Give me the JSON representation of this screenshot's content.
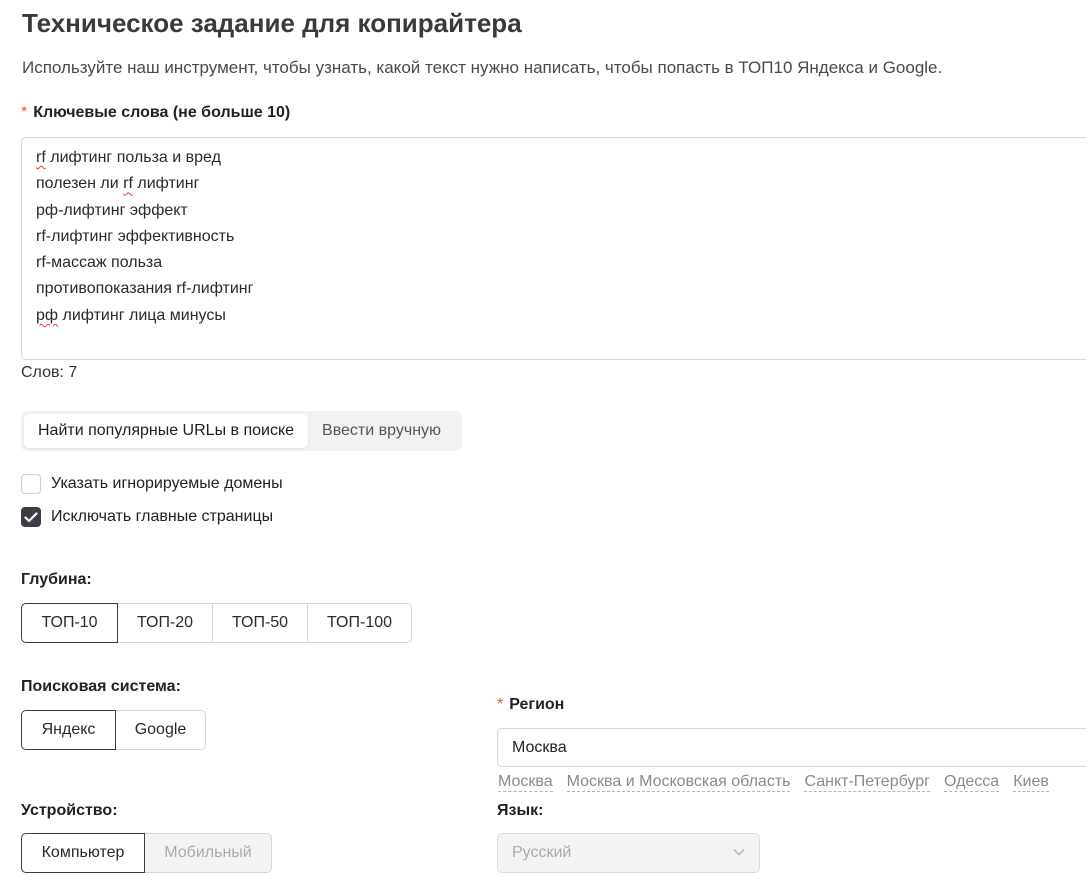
{
  "header": {
    "title": "Техническое задание для копирайтера",
    "subtitle": "Используйте наш инструмент, чтобы узнать, какой текст нужно написать, чтобы попасть в ТОП10 Яндекса и Google."
  },
  "keywords": {
    "required_mark": "*",
    "label": "Ключевые слова (не больше 10)",
    "lines": [
      {
        "pre": "",
        "err": "rf",
        "post": " лифтинг польза и вред"
      },
      {
        "pre": "полезен ли ",
        "err": "rf",
        "post": " лифтинг"
      },
      {
        "pre": "рф-лифтинг эффект",
        "err": "",
        "post": ""
      },
      {
        "pre": "rf-лифтинг эффективность",
        "err": "",
        "post": ""
      },
      {
        "pre": "rf-массаж польза",
        "err": "",
        "post": ""
      },
      {
        "pre": "противопоказания rf-лифтинг",
        "err": "",
        "post": ""
      },
      {
        "pre": "",
        "err": "рф",
        "post": " лифтинг лица минусы"
      }
    ],
    "word_count": "Слов: 7"
  },
  "source_tabs": {
    "selected": "Найти популярные URLы в поиске",
    "items": [
      "Найти популярные URLы в поиске",
      "Ввести вручную"
    ]
  },
  "options": {
    "ignore_domains": {
      "label": "Указать игнорируемые домены",
      "checked": false
    },
    "exclude_main_pages": {
      "label": "Исключать главные страницы",
      "checked": true
    }
  },
  "depth": {
    "label": "Глубина:",
    "selected": "ТОП-10",
    "options": [
      "ТОП-10",
      "ТОП-20",
      "ТОП-50",
      "ТОП-100"
    ]
  },
  "search_engine": {
    "label": "Поисковая система:",
    "selected": "Яндекс",
    "options": [
      "Яндекс",
      "Google"
    ]
  },
  "region": {
    "required_mark": "*",
    "label": "Регион",
    "value": "Москва",
    "quick_links": [
      "Москва",
      "Москва и Московская область",
      "Санкт-Петербург",
      "Одесса",
      "Киев"
    ]
  },
  "device": {
    "label": "Устройство:",
    "selected": "Компьютер",
    "options": [
      "Компьютер",
      "Мобильный"
    ],
    "disabled": [
      "Мобильный"
    ]
  },
  "language": {
    "label": "Язык:",
    "value": "Русский",
    "icon": "chevron-down-icon"
  },
  "colors": {
    "required": "#e8534b",
    "checkbox_checked": "#3b3f45",
    "spellcheck": "#e53935"
  }
}
